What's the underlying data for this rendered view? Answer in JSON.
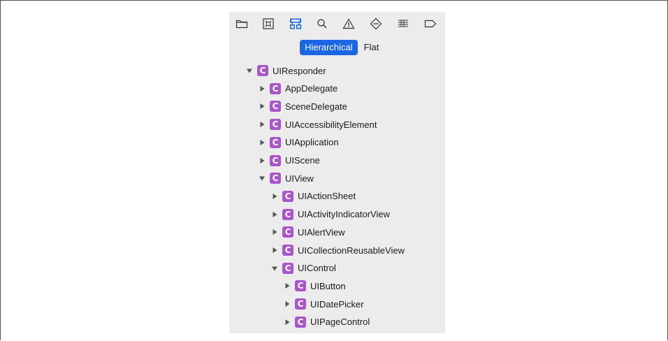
{
  "navigator": {
    "toolbar": {
      "icons": [
        "folder-icon",
        "source-control-icon",
        "symbol-hierarchy-icon",
        "search-icon",
        "warning-icon",
        "test-diamond-icon",
        "debug-list-icon",
        "breakpoint-tag-icon"
      ],
      "active_icon": "symbol-hierarchy-icon",
      "accent_color": "#1a66e5"
    },
    "segmented": {
      "hierarchical": "Hierarchical",
      "flat": "Flat",
      "selected": "Hierarchical"
    },
    "class_badge": {
      "letter": "C",
      "color": "#a956c8"
    },
    "tree": [
      {
        "label": "UIResponder",
        "depth": 0,
        "expanded": true
      },
      {
        "label": "AppDelegate",
        "depth": 1,
        "expanded": false
      },
      {
        "label": "SceneDelegate",
        "depth": 1,
        "expanded": false
      },
      {
        "label": "UIAccessibilityElement",
        "depth": 1,
        "expanded": false
      },
      {
        "label": "UIApplication",
        "depth": 1,
        "expanded": false
      },
      {
        "label": "UIScene",
        "depth": 1,
        "expanded": false
      },
      {
        "label": "UIView",
        "depth": 1,
        "expanded": true
      },
      {
        "label": "UIActionSheet",
        "depth": 2,
        "expanded": false
      },
      {
        "label": "UIActivityIndicatorView",
        "depth": 2,
        "expanded": false
      },
      {
        "label": "UIAlertView",
        "depth": 2,
        "expanded": false
      },
      {
        "label": "UICollectionReusableView",
        "depth": 2,
        "expanded": false
      },
      {
        "label": "UIControl",
        "depth": 2,
        "expanded": true
      },
      {
        "label": "UIButton",
        "depth": 3,
        "expanded": false
      },
      {
        "label": "UIDatePicker",
        "depth": 3,
        "expanded": false
      },
      {
        "label": "UIPageControl",
        "depth": 3,
        "expanded": false
      }
    ]
  }
}
